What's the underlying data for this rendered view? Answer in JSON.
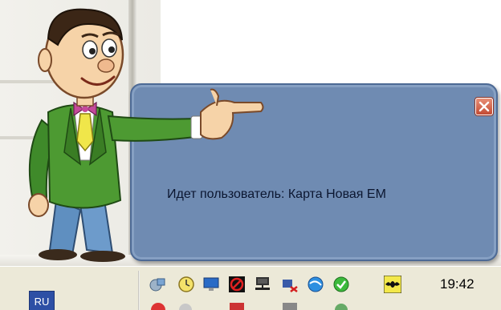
{
  "balloon": {
    "message": "Идет пользователь: Карта Новая ЕМ"
  },
  "taskbar": {
    "language": "RU",
    "clock": "19:42",
    "tray_icons": [
      "network-connection-icon",
      "clock-settings-icon",
      "monitor-icon",
      "antivirus-blocked-icon",
      "network-computer-icon",
      "volume-muted-icon",
      "browser-globe-icon",
      "green-checkmark-shield-icon",
      "bat-logo-icon"
    ]
  },
  "colors": {
    "balloon_bg": "#6f8bb2",
    "balloon_border": "#4d6a95",
    "taskbar_bg": "#ece9d8",
    "close_button": "#c34a32"
  }
}
